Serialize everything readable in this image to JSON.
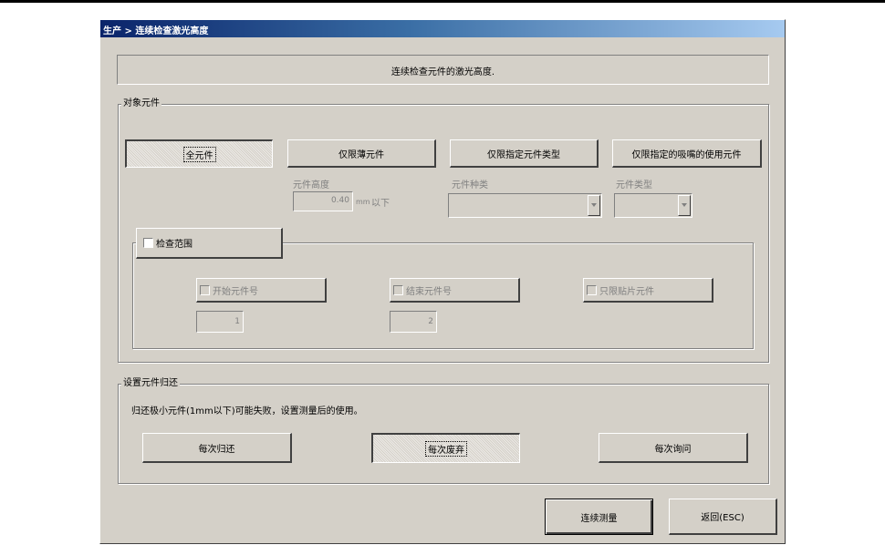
{
  "window": {
    "title": "生产 > 连续检查激光高度"
  },
  "description": "连续检查元件的激光高度.",
  "target_group": {
    "label": "对象元件",
    "buttons": [
      "全元件",
      "仅限薄元件",
      "仅限指定元件类型",
      "仅限指定的吸嘴的使用元件"
    ],
    "height_label": "元件高度",
    "height_value": "0.40",
    "height_unit": "mm",
    "height_suffix": "以下",
    "kind_label": "元件种类",
    "type_label": "元件类型"
  },
  "range_group": {
    "label": "检查范围",
    "start_label": "开始元件号",
    "end_label": "结束元件号",
    "patch_label": "只限贴片元件",
    "start_value": "1",
    "end_value": "2"
  },
  "return_group": {
    "label": "设置元件归还",
    "note": "归还极小元件(1mm以下)可能失败，设置测量后的使用。",
    "buttons": [
      "每次归还",
      "每次废弃",
      "每次询问"
    ]
  },
  "footer": {
    "measure": "连续测量",
    "back": "返回(ESC)"
  }
}
